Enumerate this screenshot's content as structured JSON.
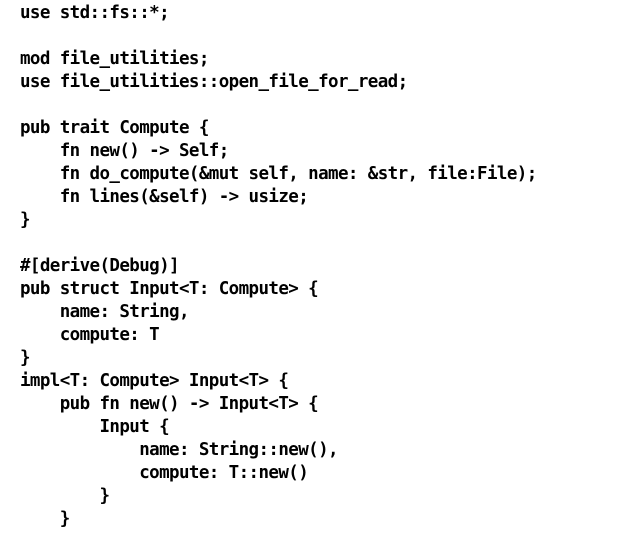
{
  "code_lines": [
    "use std::fs::*;",
    "",
    "mod file_utilities;",
    "use file_utilities::open_file_for_read;",
    "",
    "pub trait Compute {",
    "    fn new() -> Self;",
    "    fn do_compute(&mut self, name: &str, file:File);",
    "    fn lines(&self) -> usize;",
    "}",
    "",
    "#[derive(Debug)]",
    "pub struct Input<T: Compute> {",
    "    name: String,",
    "    compute: T",
    "}",
    "impl<T: Compute> Input<T> {",
    "    pub fn new() -> Input<T> {",
    "        Input {",
    "            name: String::new(),",
    "            compute: T::new()",
    "        }",
    "    }"
  ]
}
